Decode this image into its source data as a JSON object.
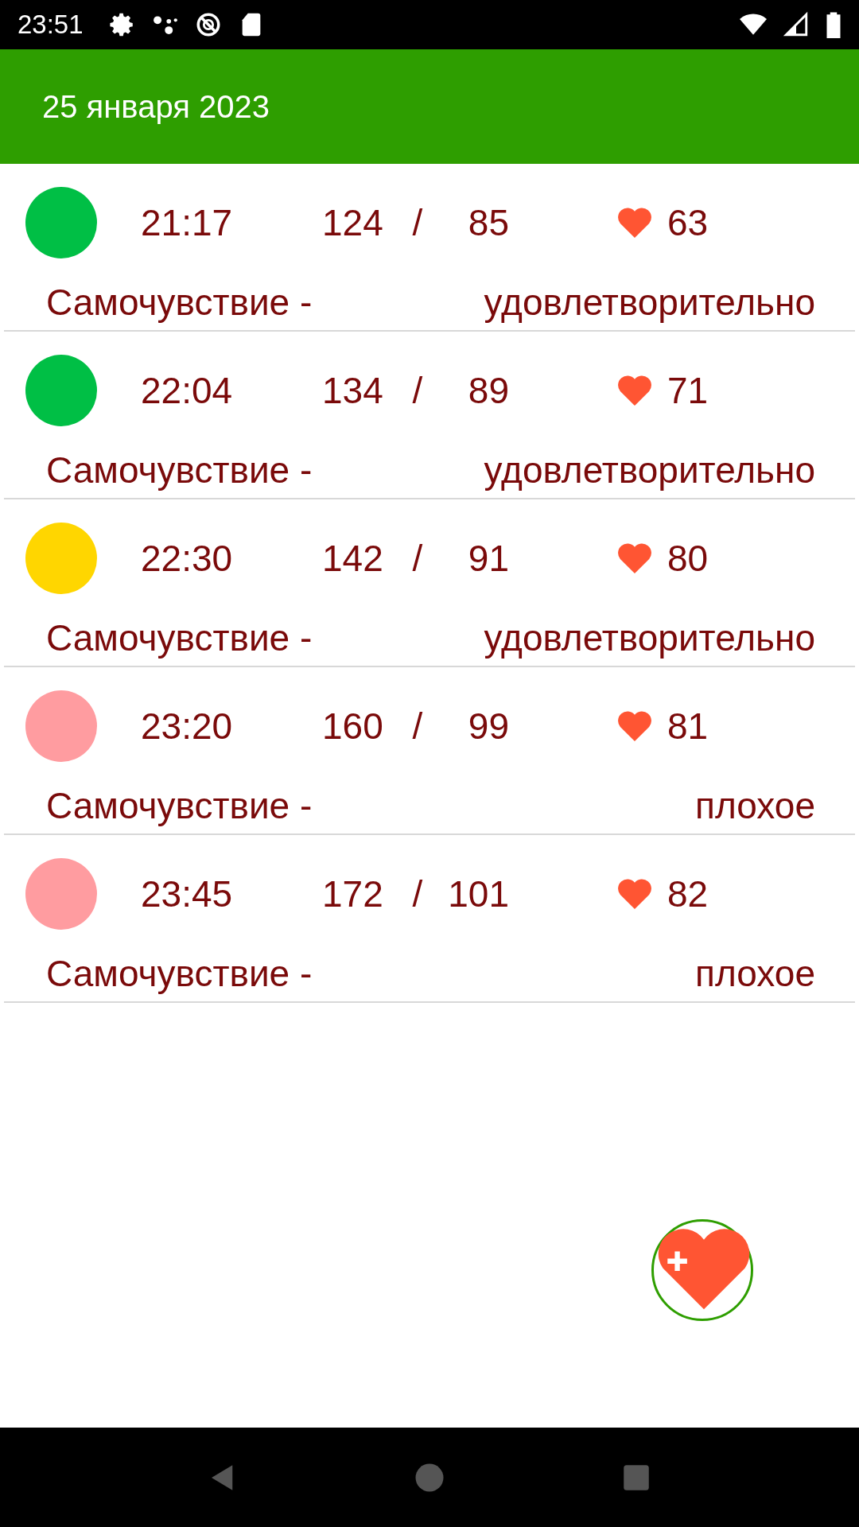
{
  "status_bar": {
    "time": "23:51"
  },
  "header": {
    "title": "25 января 2023"
  },
  "entries": [
    {
      "color": "#00bf45",
      "time": "21:17",
      "systolic": "124",
      "separator": "/",
      "diastolic": "85",
      "pulse": "63",
      "label": "Самочувствие -",
      "wellbeing": "удовлетворительно"
    },
    {
      "color": "#00bf45",
      "time": "22:04",
      "systolic": "134",
      "separator": "/",
      "diastolic": "89",
      "pulse": "71",
      "label": "Самочувствие -",
      "wellbeing": "удовлетворительно"
    },
    {
      "color": "#ffd600",
      "time": "22:30",
      "systolic": "142",
      "separator": "/",
      "diastolic": "91",
      "pulse": "80",
      "label": "Самочувствие -",
      "wellbeing": "удовлетворительно"
    },
    {
      "color": "#ff9ca0",
      "time": "23:20",
      "systolic": "160",
      "separator": "/",
      "diastolic": "99",
      "pulse": "81",
      "label": "Самочувствие -",
      "wellbeing": "плохое"
    },
    {
      "color": "#ff9ca0",
      "time": "23:45",
      "systolic": "172",
      "separator": "/",
      "diastolic": "101",
      "pulse": "82",
      "label": "Самочувствие -",
      "wellbeing": "плохое"
    }
  ]
}
